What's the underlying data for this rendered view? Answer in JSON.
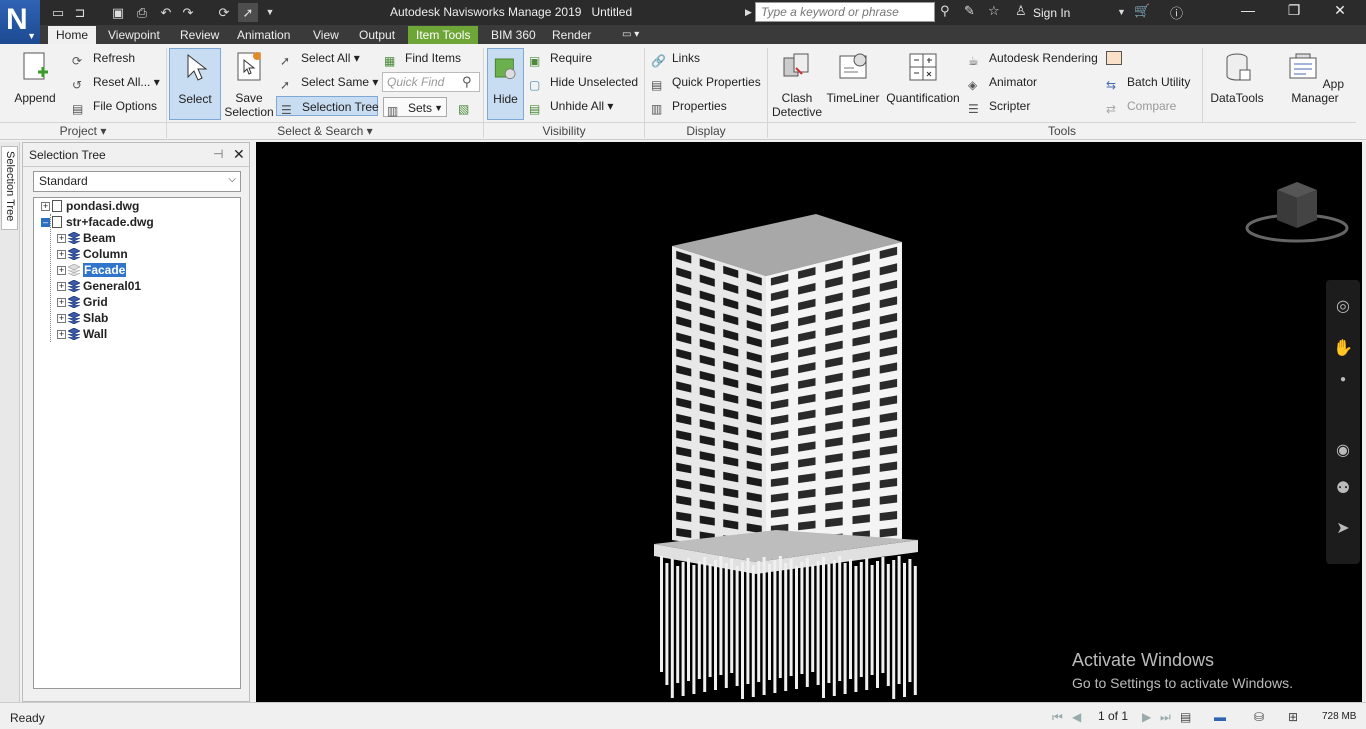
{
  "app": {
    "logo_letter": "N",
    "title": "Autodesk Navisworks Manage 2019",
    "document": "Untitled",
    "search_placeholder": "Type a keyword or phrase",
    "sign_in": "Sign In"
  },
  "tabs": [
    "Home",
    "Viewpoint",
    "Review",
    "Animation",
    "View",
    "Output",
    "Item Tools",
    "BIM 360",
    "Render"
  ],
  "ribbon": {
    "project": {
      "label": "Project",
      "append": "Append",
      "refresh": "Refresh",
      "reset_all": "Reset All...",
      "file_options": "File Options"
    },
    "select_search": {
      "label": "Select & Search",
      "select": "Select",
      "save_selection": "Save Selection",
      "select_all": "Select All",
      "select_same": "Select Same",
      "selection_tree": "Selection Tree",
      "find_items": "Find Items",
      "quick_find_placeholder": "Quick Find",
      "sets": "Sets"
    },
    "visibility": {
      "label": "Visibility",
      "hide": "Hide",
      "require": "Require",
      "hide_unselected": "Hide Unselected",
      "unhide_all": "Unhide All"
    },
    "display": {
      "label": "Display",
      "links": "Links",
      "quick_properties": "Quick Properties",
      "properties": "Properties"
    },
    "tools": {
      "label": "Tools",
      "clash_detective": "Clash Detective",
      "timeliner": "TimeLiner",
      "quantification": "Quantification",
      "autodesk_rendering": "Autodesk Rendering",
      "animator": "Animator",
      "scripter": "Scripter",
      "batch_utility": "Batch Utility",
      "compare": "Compare",
      "datatools": "DataTools",
      "app_manager": "App Manager"
    }
  },
  "side_tab": "Selection Tree",
  "tree_panel": {
    "title": "Selection Tree",
    "mode": "Standard",
    "roots": [
      "pondasi.dwg",
      "str+facade.dwg"
    ],
    "children": [
      "Beam",
      "Column",
      "Facade",
      "General01",
      "Grid",
      "Slab",
      "Wall"
    ],
    "selected": "Facade"
  },
  "watermark": {
    "title": "Activate Windows",
    "subtitle": "Go to Settings to activate Windows."
  },
  "status": {
    "text": "Ready",
    "page": "1 of 1",
    "memory": "728 MB"
  },
  "colors": {
    "accent_blue": "#2f63b3",
    "item_tools_tab": "#6ea537",
    "selection": "#3075c9"
  }
}
